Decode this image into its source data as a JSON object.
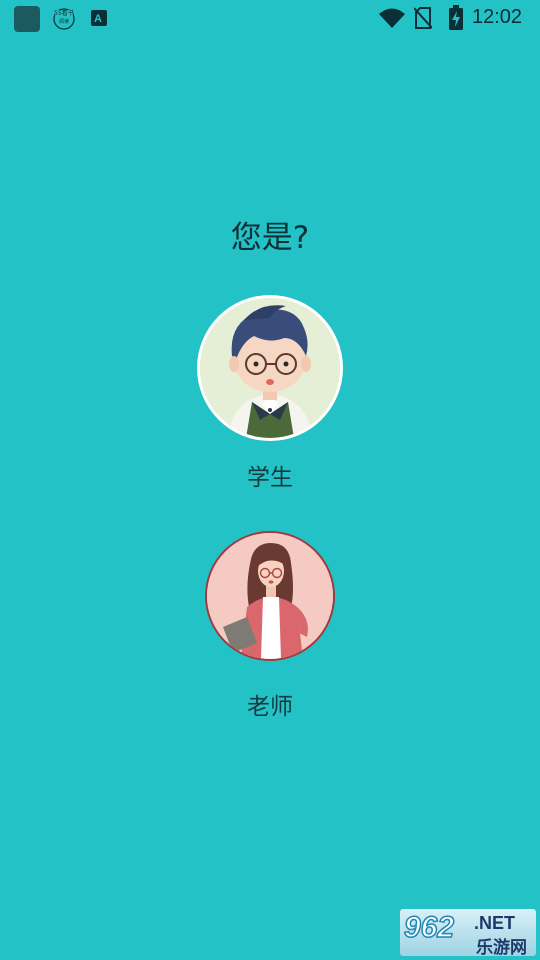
{
  "status_bar": {
    "time": "12:02",
    "icons": [
      "app-icon",
      "notification-logo-icon",
      "notification-a-icon",
      "wifi-icon",
      "no-sim-icon",
      "battery-charging-icon"
    ],
    "notification_logo_text": "55 看书 阅读"
  },
  "prompt": {
    "question": "您是?"
  },
  "roles": [
    {
      "label": "学生",
      "avatar": "student-avatar"
    },
    {
      "label": "老师",
      "avatar": "teacher-avatar"
    }
  ],
  "watermark": {
    "number": "962",
    "domain": ".NET",
    "brand": "乐游网"
  },
  "colors": {
    "background": "#22c2c6",
    "text": "#173a40",
    "student_bg": "#e4efd6",
    "teacher_bg": "#f4cac2",
    "teacher_ring": "#a03a3e"
  }
}
